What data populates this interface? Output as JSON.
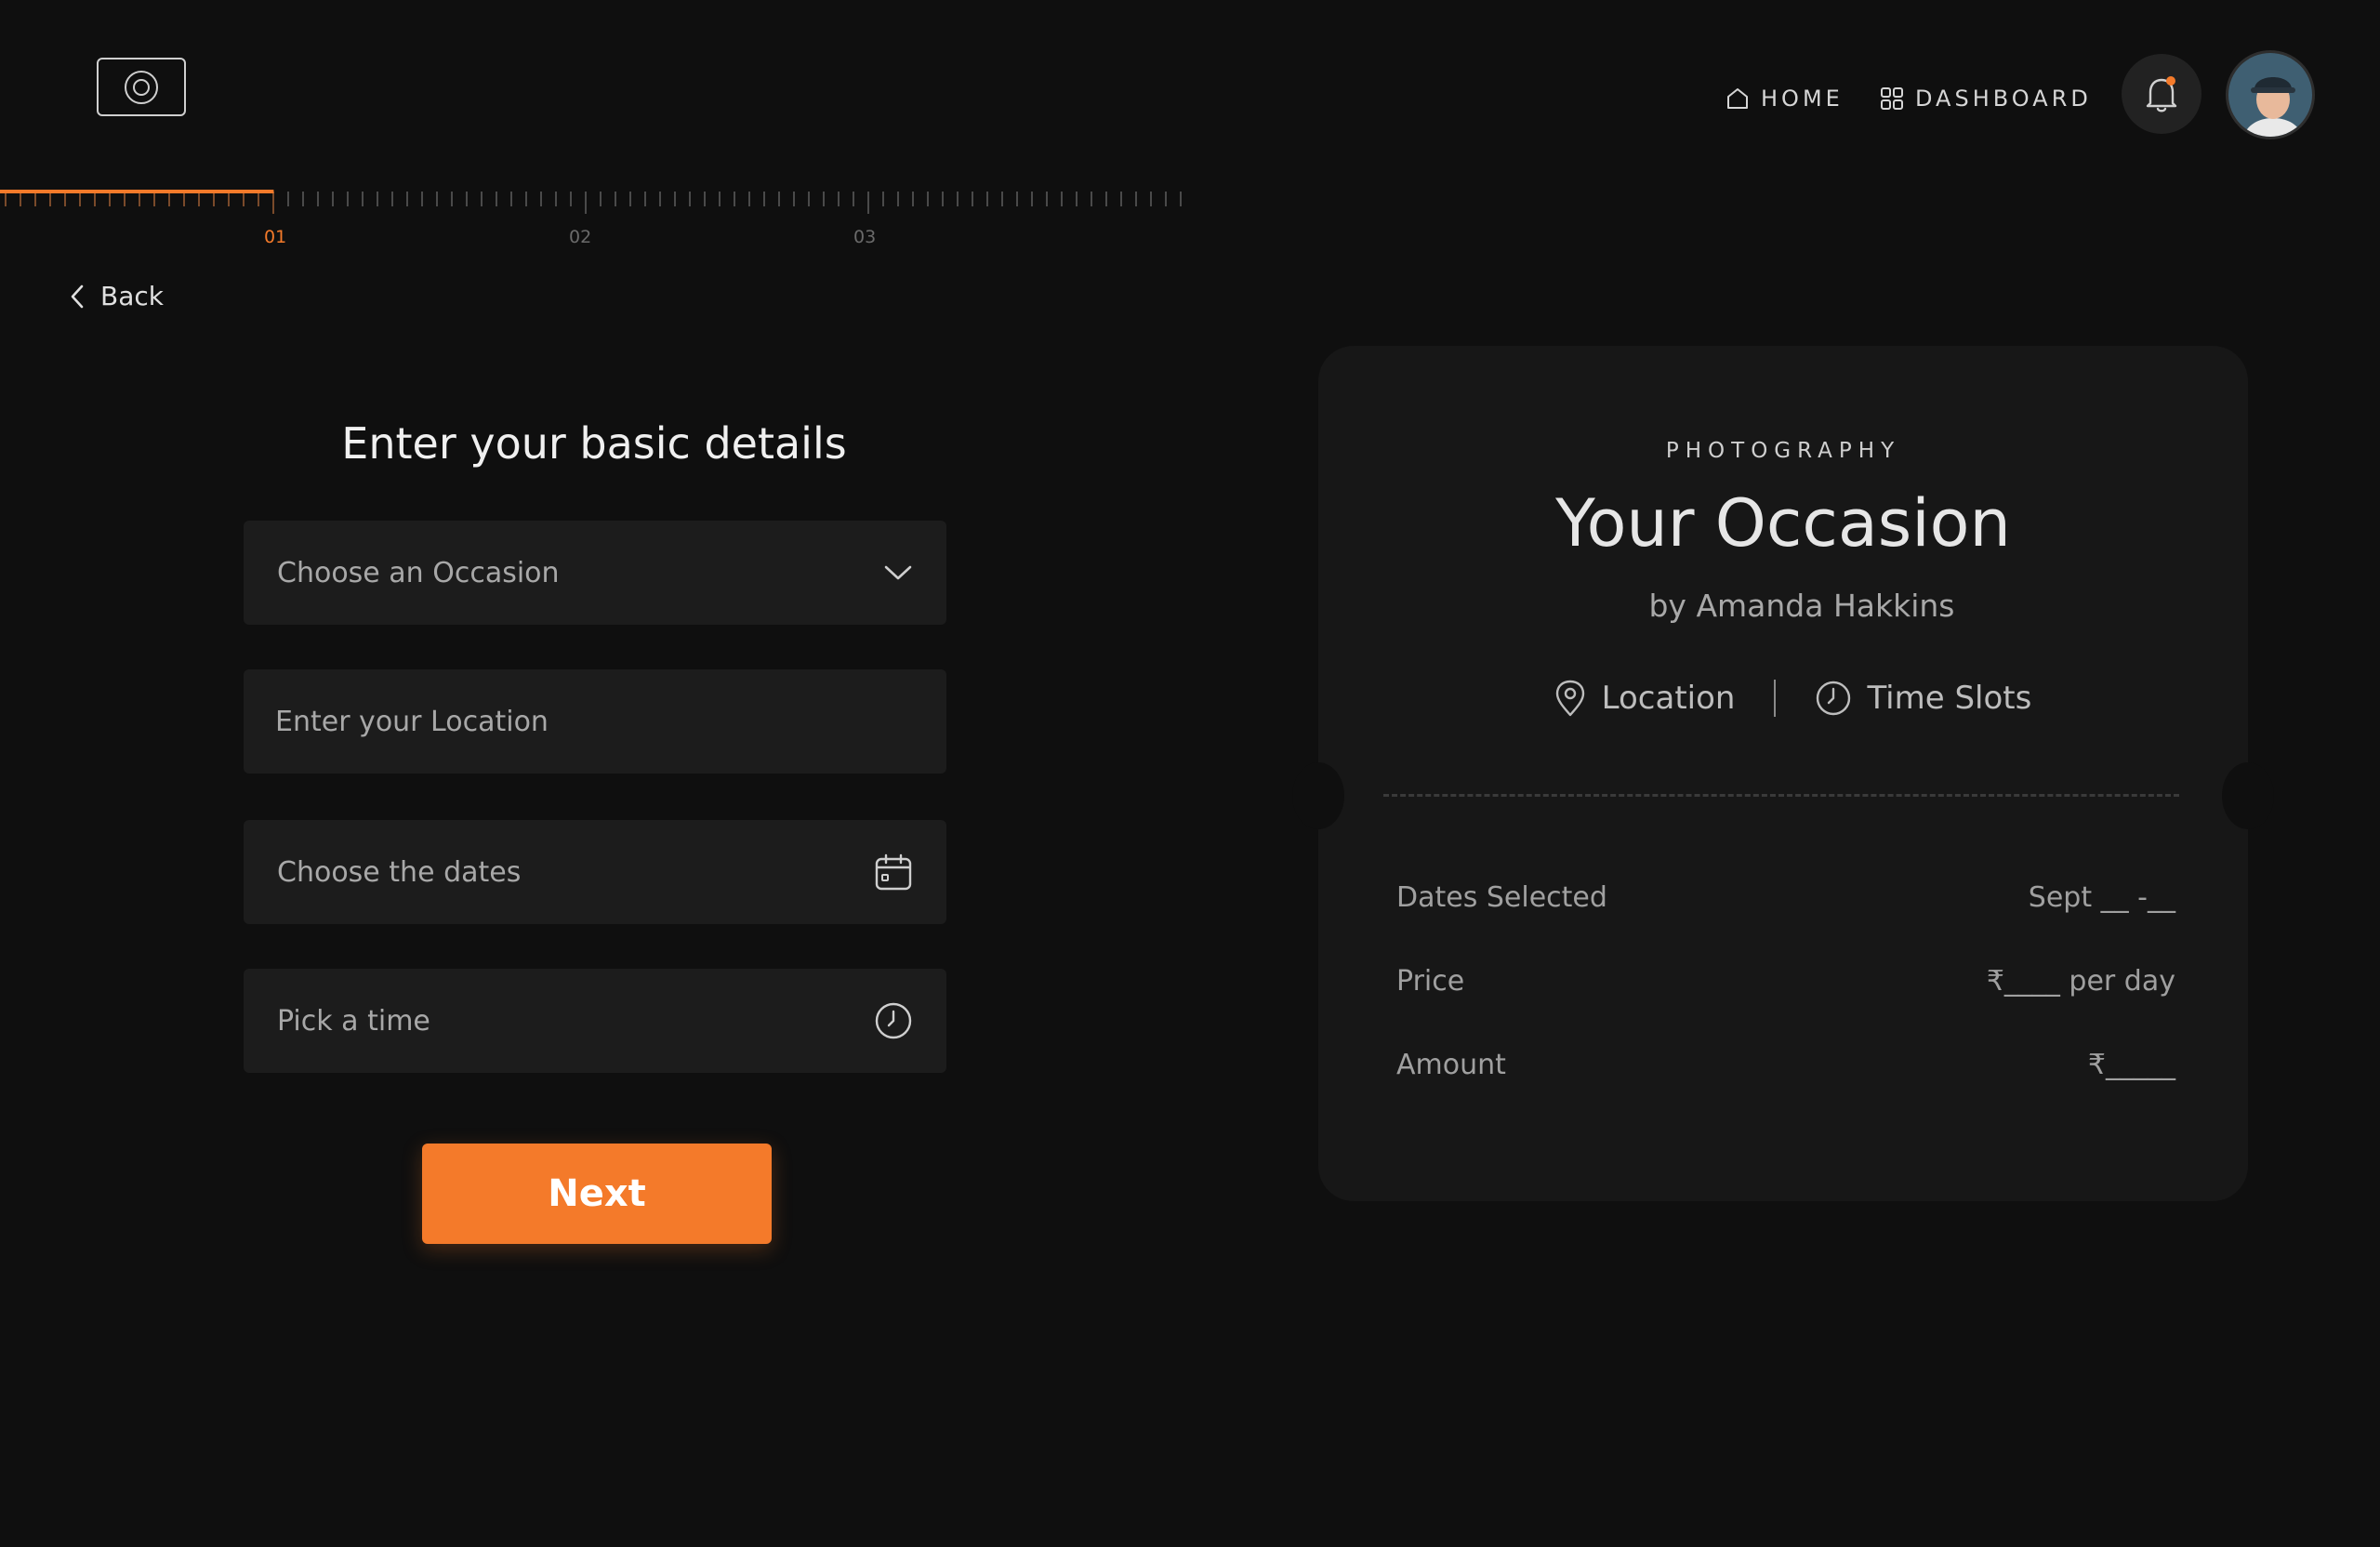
{
  "header": {
    "nav": {
      "home_label": "HOME",
      "dashboard_label": "DASHBOARD"
    },
    "notification": {
      "has_unread": true
    },
    "accent_color": "#f47a2a"
  },
  "progress": {
    "steps": [
      "01",
      "02",
      "03"
    ],
    "current_step": 1,
    "fill_fraction": 0.23
  },
  "back_label": "Back",
  "form": {
    "title": "Enter your basic details",
    "occasion_placeholder": "Choose an Occasion",
    "location_placeholder": "Enter your Location",
    "dates_placeholder": "Choose the dates",
    "time_placeholder": "Pick a time",
    "next_label": "Next"
  },
  "card": {
    "kicker": "PHOTOGRAPHY",
    "title": "Your Occasion",
    "byline": "by Amanda Hakkins",
    "location_label": "Location",
    "time_slots_label": "Time Slots",
    "rows": [
      {
        "label": "Dates Selected",
        "value": "Sept __ -__"
      },
      {
        "label": "Price",
        "value": "₹____ per day"
      },
      {
        "label": "Amount",
        "value": "₹_____"
      }
    ]
  },
  "icons": {
    "logo": "camera-lens-icon",
    "home": "home-icon",
    "dashboard": "grid-icon",
    "bell": "bell-icon",
    "back": "chevron-left-icon",
    "dropdown": "chevron-down-icon",
    "calendar": "calendar-icon",
    "clock": "clock-icon",
    "location": "map-pin-icon"
  }
}
